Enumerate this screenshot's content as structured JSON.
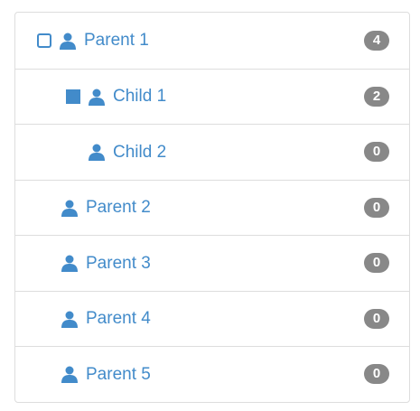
{
  "colors": {
    "accent": "#428bca",
    "badge": "#888888",
    "border": "#dddddd"
  },
  "tree": {
    "nodes": [
      {
        "label": "Parent 1",
        "badge": "4",
        "toggle": "collapsed",
        "icon": "user-icon"
      },
      {
        "label": "Child 1",
        "badge": "2",
        "toggle": "expanded",
        "icon": "user-icon"
      },
      {
        "label": "Child 2",
        "badge": "0",
        "toggle": "none",
        "icon": "user-icon"
      },
      {
        "label": "Parent 2",
        "badge": "0",
        "toggle": "none",
        "icon": "user-icon"
      },
      {
        "label": "Parent 3",
        "badge": "0",
        "toggle": "none",
        "icon": "user-icon"
      },
      {
        "label": "Parent 4",
        "badge": "0",
        "toggle": "none",
        "icon": "user-icon"
      },
      {
        "label": "Parent 5",
        "badge": "0",
        "toggle": "none",
        "icon": "user-icon"
      }
    ]
  }
}
